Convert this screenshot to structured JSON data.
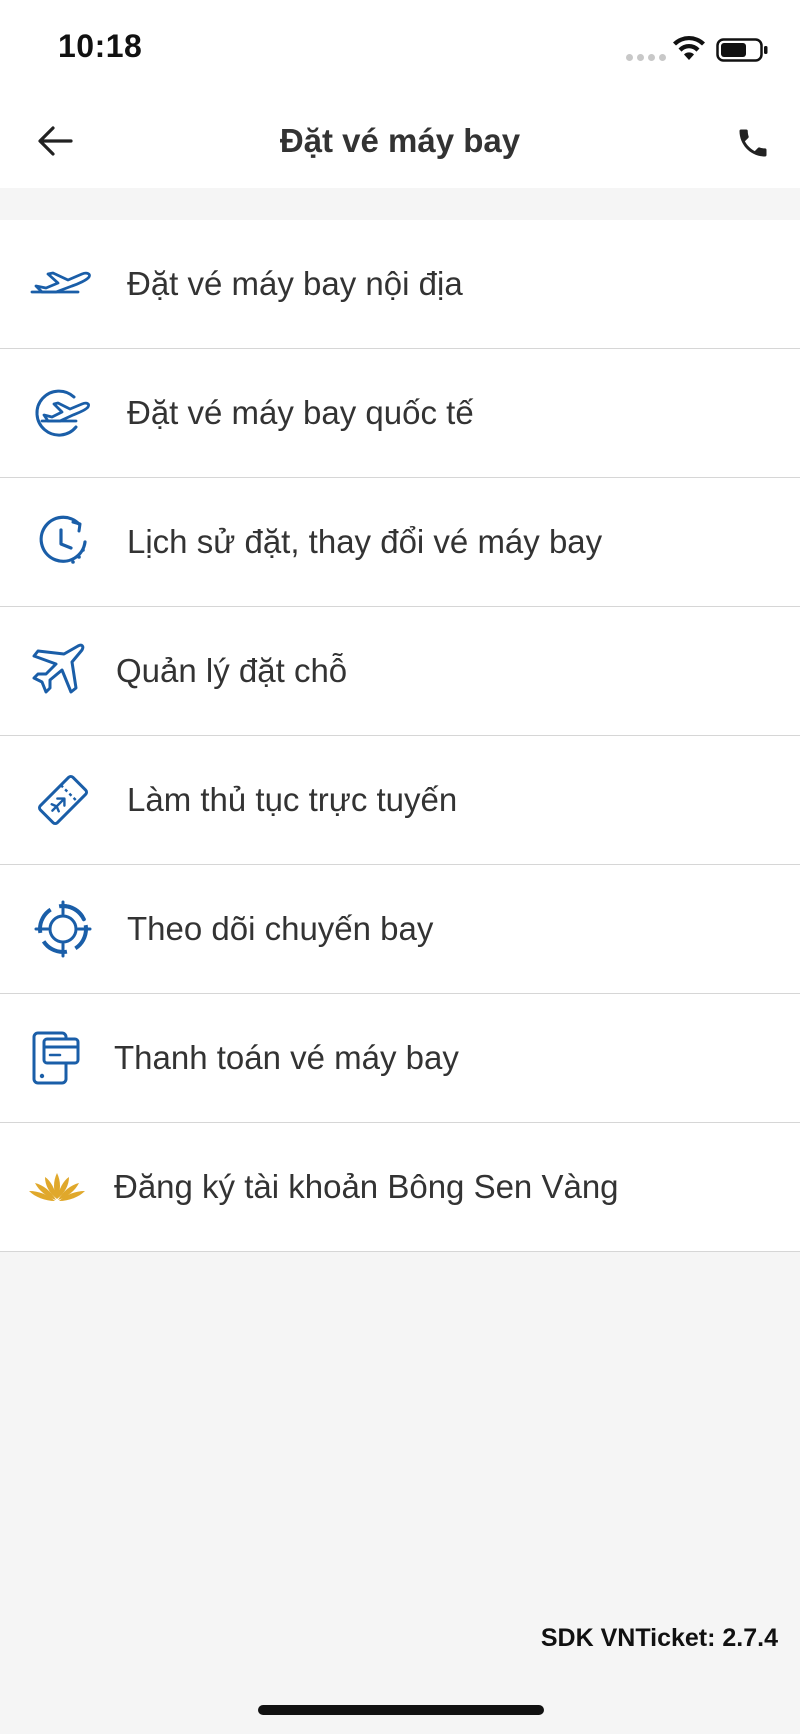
{
  "status_bar": {
    "time": "10:18"
  },
  "header": {
    "title": "Đặt vé máy bay"
  },
  "menu": {
    "items": [
      {
        "label": "Đặt vé máy bay nội địa",
        "icon": "airplane-takeoff-icon"
      },
      {
        "label": "Đặt vé máy bay quốc tế",
        "icon": "globe-airplane-icon"
      },
      {
        "label": "Lịch sử đặt, thay đổi vé máy bay",
        "icon": "clock-history-icon"
      },
      {
        "label": "Quản lý đặt chỗ",
        "icon": "airplane-icon"
      },
      {
        "label": "Làm thủ tục trực tuyến",
        "icon": "boarding-pass-icon"
      },
      {
        "label": "Theo dõi chuyến bay",
        "icon": "target-tracking-icon"
      },
      {
        "label": "Thanh toán vé máy bay",
        "icon": "payment-card-phone-icon"
      },
      {
        "label": "Đăng ký tài khoản Bông Sen Vàng",
        "icon": "golden-lotus-icon"
      }
    ]
  },
  "footer": {
    "sdk_version": "SDK VNTicket: 2.7.4"
  },
  "colors": {
    "icon_blue": "#1a5ea8",
    "lotus_gold": "#e0a82b",
    "divider": "#d6d6d6",
    "background": "#f5f5f5"
  }
}
